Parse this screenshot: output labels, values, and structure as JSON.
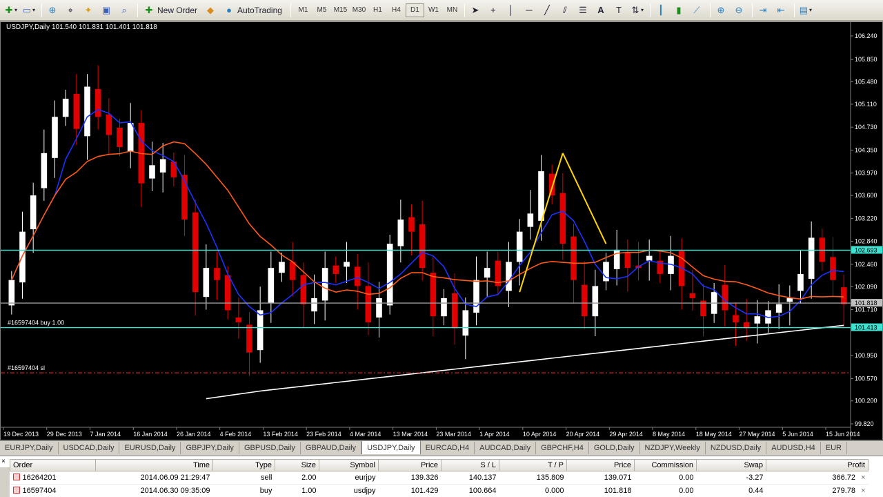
{
  "toolbar": {
    "new_order_label": "New Order",
    "autotrading_label": "AutoTrading",
    "timeframes": [
      "M1",
      "M5",
      "M15",
      "M30",
      "H1",
      "H4",
      "D1",
      "W1",
      "MN"
    ],
    "active_timeframe": "D1",
    "icons": [
      "new-chart-icon",
      "profiles-icon",
      "zoom-in-icon",
      "crosshair-icon",
      "market-watch-icon",
      "navigator-icon",
      "data-window-icon",
      "new-order-icon",
      "metaeditor-icon",
      "autotrading-icon",
      "cursor-icon",
      "crosshair-tool-icon",
      "vertical-line-icon",
      "horizontal-line-icon",
      "trendline-icon",
      "equidistant-channel-icon",
      "fibonacci-icon",
      "text-icon",
      "text-label-icon",
      "arrows-icon",
      "bar-chart-icon",
      "candlesticks-icon",
      "line-chart-icon",
      "zoom-in-icon",
      "zoom-out-icon",
      "auto-scroll-icon",
      "chart-shift-icon",
      "periods-icon"
    ]
  },
  "chart": {
    "title": "USDJPY,Daily  101.540 101.831 101.401 101.818",
    "price_labels": [
      "106.240",
      "105.850",
      "105.480",
      "105.110",
      "104.730",
      "104.350",
      "103.970",
      "103.600",
      "103.220",
      "102.840",
      "102.460",
      "102.090",
      "101.710",
      "100.950",
      "100.570",
      "100.200",
      "99.820"
    ],
    "price_line_labels": {
      "resistance": "102.693",
      "bid": "101.818",
      "support": "101.413"
    },
    "date_labels": [
      "19 Dec 2013",
      "29 Dec 2013",
      "7 Jan 2014",
      "16 Jan 2014",
      "26 Jan 2014",
      "4 Feb 2014",
      "13 Feb 2014",
      "23 Feb 2014",
      "4 Mar 2014",
      "13 Mar 2014",
      "23 Mar 2014",
      "1 Apr 2014",
      "10 Apr 2014",
      "20 Apr 2014",
      "29 Apr 2014",
      "8 May 2014",
      "18 May 2014",
      "27 May 2014",
      "5 Jun 2014",
      "15 Jun 2014"
    ],
    "order_labels": {
      "buy": "#16597404 buy 1.00",
      "sl": "#16597404 sl"
    },
    "colors": {
      "background": "#000000",
      "bull": "#ffffff",
      "bear": "#e00000",
      "ma_fast": "#1a33ff",
      "ma_mid": "#ff5a1a",
      "ma_slow": "#ffffff",
      "level": "#40e0d0",
      "trendline": "#ffd700",
      "sl": "#ff3030"
    }
  },
  "chart_data": {
    "type": "candlestick",
    "symbol": "USDJPY",
    "timeframe": "Daily",
    "ylim": [
      99.82,
      106.24
    ],
    "last": {
      "open": 101.54,
      "high": 101.831,
      "low": 101.401,
      "close": 101.818
    },
    "horizontal_levels": [
      102.693,
      101.818,
      101.413
    ],
    "stop_loss": 100.664,
    "closes": [
      102.2,
      103.0,
      103.6,
      104.3,
      104.9,
      105.2,
      104.7,
      105.4,
      104.9,
      104.6,
      104.4,
      104.8,
      103.8,
      104.1,
      104.2,
      103.9,
      103.2,
      102.0,
      102.4,
      102.2,
      101.7,
      101.5,
      101.0,
      101.7,
      102.4,
      102.5,
      102.2,
      101.8,
      101.9,
      102.4,
      102.3,
      102.5,
      102.1,
      101.5,
      101.9,
      102.8,
      103.2,
      103.0,
      102.4,
      101.6,
      101.9,
      101.4,
      101.7,
      102.2,
      102.4,
      102.1,
      102.5,
      103.0,
      103.3,
      104.0,
      103.6,
      102.8,
      102.2,
      101.6,
      102.1,
      102.5,
      102.7,
      102.4,
      102.4,
      102.6,
      102.3,
      102.6,
      102.1,
      101.9,
      101.6,
      102.0,
      101.7,
      101.5,
      101.4,
      101.6,
      101.7,
      101.8,
      101.9,
      102.3,
      102.9,
      102.5,
      102.2,
      101.8
    ]
  },
  "tabs": [
    "EURJPY,Daily",
    "USDCAD,Daily",
    "EURUSD,Daily",
    "GBPJPY,Daily",
    "GBPUSD,Daily",
    "GBPAUD,Daily",
    "USDJPY,Daily",
    "EURCAD,H4",
    "AUDCAD,Daily",
    "GBPCHF,H4",
    "GOLD,Daily",
    "NZDJPY,Weekly",
    "NZDUSD,Daily",
    "AUDUSD,H4",
    "EUR"
  ],
  "active_tab": "USDJPY,Daily",
  "terminal": {
    "columns": [
      "Order",
      "Time",
      "Type",
      "Size",
      "Symbol",
      "Price",
      "S / L",
      "T / P",
      "Price",
      "Commission",
      "Swap",
      "Profit"
    ],
    "rows": [
      {
        "order": "16264201",
        "time": "2014.06.09 21:29:47",
        "type": "sell",
        "size": "2.00",
        "symbol": "eurjpy",
        "price": "139.326",
        "sl": "140.137",
        "tp": "135.809",
        "price2": "139.071",
        "commission": "0.00",
        "swap": "-3.27",
        "profit": "366.72"
      },
      {
        "order": "16597404",
        "time": "2014.06.30 09:35:09",
        "type": "buy",
        "size": "1.00",
        "symbol": "usdjpy",
        "price": "101.429",
        "sl": "100.664",
        "tp": "0.000",
        "price2": "101.818",
        "commission": "0.00",
        "swap": "0.44",
        "profit": "279.78"
      }
    ]
  }
}
